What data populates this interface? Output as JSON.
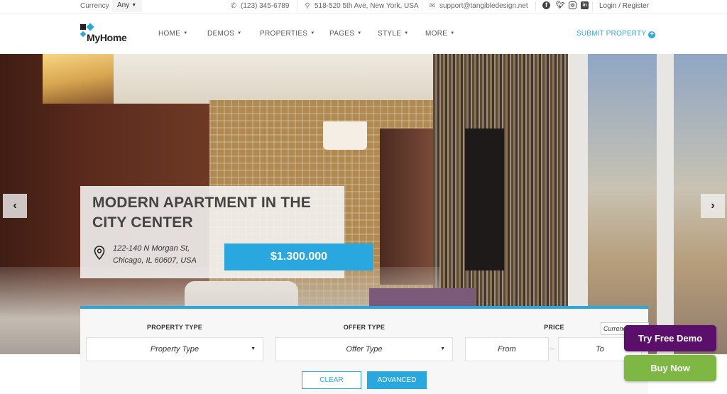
{
  "topbar": {
    "currency_label": "Currency",
    "currency_value": "Any",
    "phone": "(123) 345-6789",
    "address": "518-520 5th Ave, New York, USA",
    "email": "support@tangibledesign.net",
    "social": [
      "facebook",
      "twitter",
      "instagram",
      "linkedin"
    ],
    "login": "Login / Register"
  },
  "header": {
    "logo_text": "MyHome",
    "nav": [
      {
        "label": "HOME"
      },
      {
        "label": "DEMOS"
      },
      {
        "label": "PROPERTIES"
      },
      {
        "label": "PAGES"
      },
      {
        "label": "STYLE"
      },
      {
        "label": "MORE"
      }
    ],
    "submit_label": "SUBMIT PROPERTY"
  },
  "hero": {
    "title": "MODERN APARTMENT IN THE CITY CENTER",
    "address_line1": "122-140 N Morgan St,",
    "address_line2": "Chicago, IL 60607, USA",
    "price": "$1.300.000",
    "prev_icon": "chevron-left",
    "next_icon": "chevron-right"
  },
  "search": {
    "property_type_label": "PROPERTY TYPE",
    "property_type_value": "Property Type",
    "offer_type_label": "OFFER TYPE",
    "offer_type_value": "Offer Type",
    "price_label": "PRICE",
    "currency_placeholder": "Currency",
    "price_from": "From",
    "price_to": "To",
    "dash": "–",
    "clear_label": "CLEAR",
    "advanced_label": "ADVANCED"
  },
  "promo": {
    "try_demo": "Try Free Demo",
    "buy_now": "Buy Now"
  },
  "colors": {
    "accent": "#29a8e0",
    "try_demo_bg": "#5a0f6b",
    "buy_now_bg": "#7fb744"
  }
}
